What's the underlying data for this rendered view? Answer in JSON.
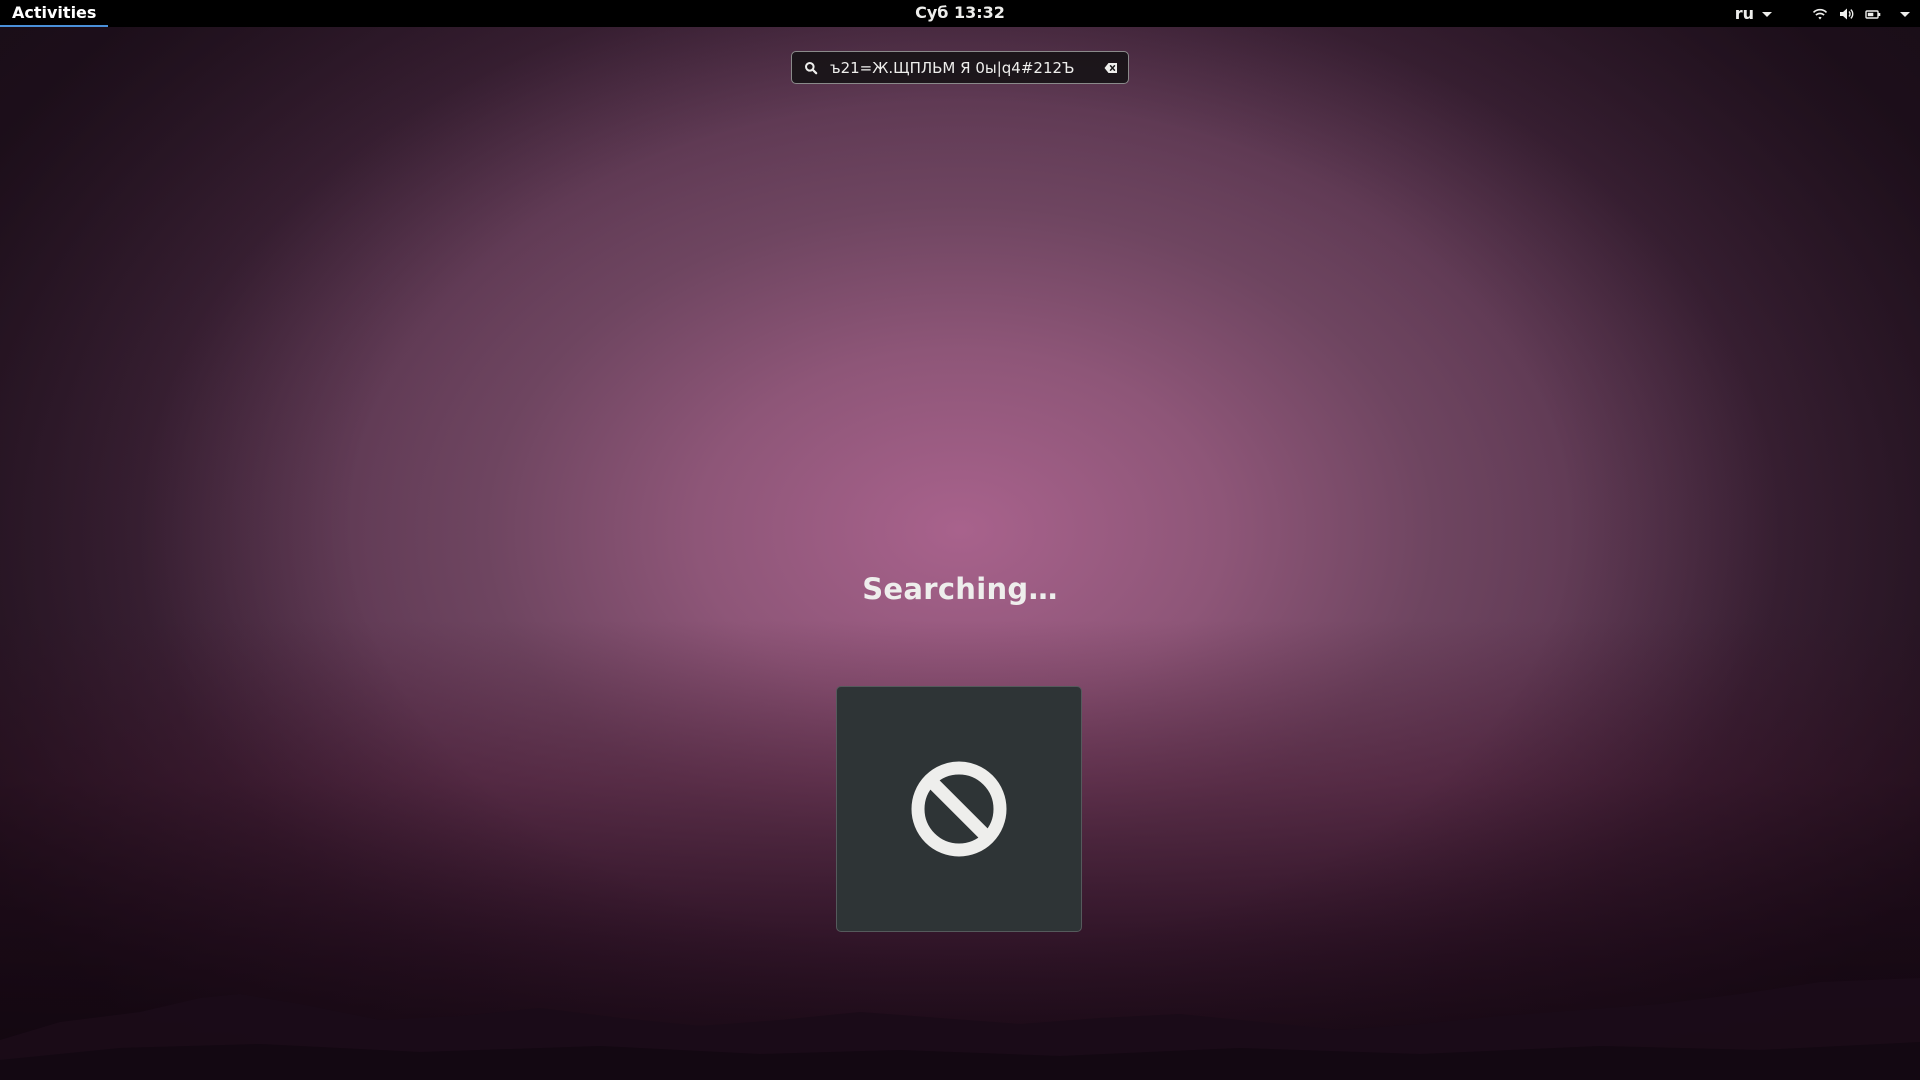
{
  "topbar": {
    "activities_label": "Activities",
    "clock": "Суб 13:32",
    "input_language": "ru",
    "tray_icons": [
      "wifi-icon",
      "volume-icon",
      "battery-icon",
      "system-menu-caret-icon"
    ]
  },
  "search": {
    "value": "ъ21=Ж.ЩПЛЬМ Я 0ы|q4#212Ъ",
    "search_icon": "search-icon",
    "clear_icon": "clear-text-icon"
  },
  "status": {
    "text": "Searching…"
  },
  "result_tile": {
    "icon": "no-entry-icon"
  },
  "colors": {
    "topbar_bg": "#000000",
    "activities_underline": "#4a90d9",
    "tile_bg": "#2e3436",
    "text": "#eeeeec",
    "wallpaper_center": "#a8628c"
  }
}
